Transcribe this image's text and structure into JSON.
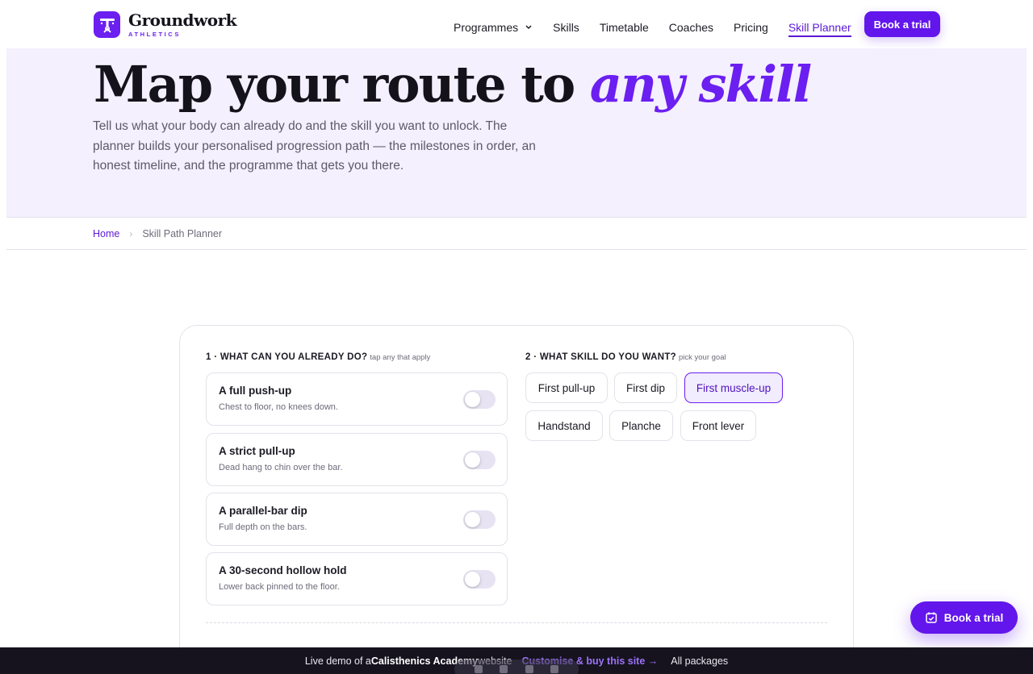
{
  "brand": {
    "name": "Groundwork",
    "sub": "ATHLETICS",
    "accent": "#6b1ff0"
  },
  "nav": {
    "items": [
      "Programmes",
      "Skills",
      "Timetable",
      "Coaches",
      "Pricing",
      "Skill Planner"
    ],
    "active": "Skill Planner",
    "cta": "Book a trial"
  },
  "hero": {
    "title_main": "Map your route to ",
    "title_accent": "any skill",
    "subtitle": "Tell us what your body can already do and the skill you want to unlock. The planner builds your personalised progression path — the milestones in order, an honest timeline, and the programme that gets you there."
  },
  "breadcrumb": {
    "home": "Home",
    "separator": "›",
    "current": "Skill Path Planner"
  },
  "step1": {
    "label": "1 · WHAT CAN YOU ALREADY DO?",
    "hint": "tap any that apply",
    "items": [
      {
        "title": "A full push-up",
        "desc": "Chest to floor, no knees down.",
        "on": false
      },
      {
        "title": "A strict pull-up",
        "desc": "Dead hang to chin over the bar.",
        "on": false
      },
      {
        "title": "A parallel-bar dip",
        "desc": "Full depth on the bars.",
        "on": false
      },
      {
        "title": "A 30-second hollow hold",
        "desc": "Lower back pinned to the floor.",
        "on": false
      }
    ]
  },
  "step2": {
    "label": "2 · WHAT SKILL DO YOU WANT?",
    "hint": "pick your goal",
    "skills": [
      "First pull-up",
      "First dip",
      "First muscle-up",
      "Handstand",
      "Planche",
      "Front lever"
    ],
    "selected": "First muscle-up"
  },
  "floating_cta": {
    "label": "Book a trial",
    "icon": "calendar-check-icon"
  },
  "demo_bar": {
    "prefix": "Live demo of a ",
    "site": "Calisthenics Academy",
    "suffix": " website",
    "link": "Customise & buy this site →",
    "all": "All packages"
  }
}
